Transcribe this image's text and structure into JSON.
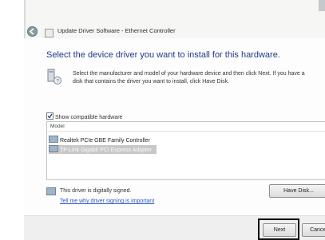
{
  "window": {
    "title": "Update Driver Software - Ethernet Controller"
  },
  "page": {
    "heading": "Select the device driver you want to install for this hardware.",
    "instructions_line1": "Select the manufacturer and model of your hardware device and then click Next. If you have a",
    "instructions_line2": "disk that contains the driver you want to install, click Have Disk."
  },
  "compatible": {
    "label": "Show compatible hardware",
    "checked": true
  },
  "list": {
    "header": "Model",
    "items": [
      "Realtek PCIe GBE Family Controller",
      "TP-Link Gigabit PCI Express Adapter"
    ],
    "selected_index": 1
  },
  "signing": {
    "status": "This driver is digitally signed.",
    "link": "Tell me why driver signing is important"
  },
  "buttons": {
    "have_disk": "Have Disk...",
    "next": "Next",
    "cancel": "Cancel"
  },
  "icons": {
    "back": "back-arrow-icon",
    "app": "update-driver-icon",
    "hardware": "hardware-disk-icon",
    "network": "network-adapter-icon",
    "signed": "signed-driver-icon"
  }
}
